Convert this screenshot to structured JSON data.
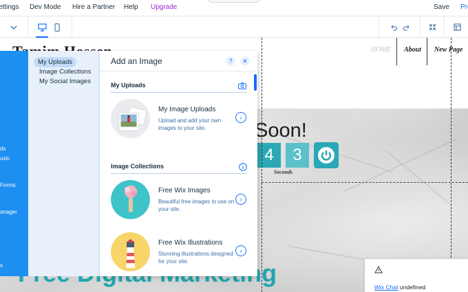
{
  "menu": {
    "settings": "ettings",
    "dev_mode": "Dev Mode",
    "hire": "Hire a Partner",
    "help": "Help",
    "upgrade": "Upgrade",
    "save": "Save",
    "preview": "Pre"
  },
  "site": {
    "name": "Tamim Hossen",
    "nav": [
      "HOME",
      "About",
      "New Page"
    ],
    "coming_soon": "Soon!",
    "digits": [
      "4",
      "3"
    ],
    "seconds_label": "Seconds",
    "headline": "Free Digital Marketing"
  },
  "notice": {
    "link": "Wix Chat",
    "text": "undefined"
  },
  "leftbar": {
    "items": [
      "ds",
      "usic",
      "Forms",
      "anager",
      "s"
    ]
  },
  "subnav": {
    "items": [
      "My Uploads",
      "Image Collections",
      "My Social Images"
    ]
  },
  "panel": {
    "title": "Add an Image",
    "help_label": "?",
    "close_label": "✕",
    "section1": "My Uploads",
    "section2": "Image Collections",
    "items": [
      {
        "title": "My Image Uploads",
        "desc": "Upload and add your own images to your site."
      },
      {
        "title": "Free Wix Images",
        "desc": "Beautiful free images to use on your site."
      },
      {
        "title": "Free Wix Illustrations",
        "desc": "Stunning illustrations designed for your site."
      }
    ]
  },
  "colors": {
    "accent": "#116dff",
    "teal": "#2aa8b5",
    "leftbar": "#1d8ff0",
    "upgrade": "#9a27d5"
  },
  "icons": [
    "chevron-down-icon",
    "desktop-icon",
    "mobile-icon",
    "undo-icon",
    "redo-icon",
    "collapse-icon",
    "layout-icon",
    "camera-icon",
    "info-icon",
    "warning-icon",
    "power-icon",
    "chevron-right-icon"
  ]
}
